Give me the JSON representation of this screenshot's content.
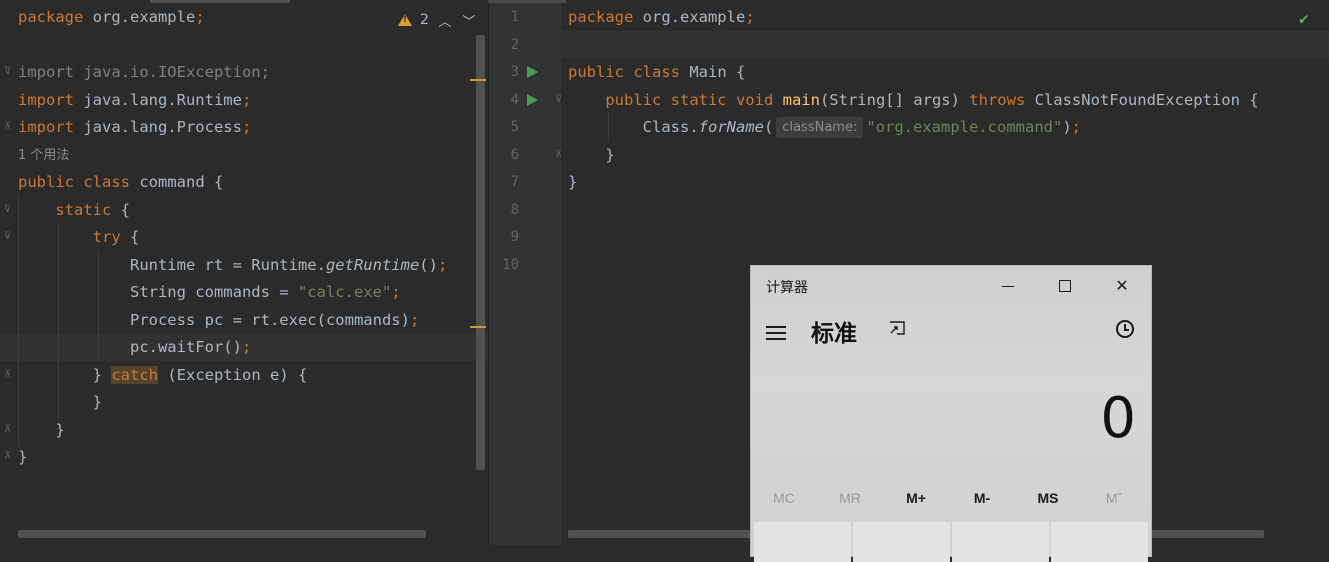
{
  "left_editor": {
    "warnings": {
      "count": "2"
    },
    "lines": [
      "package org.example;",
      "",
      "import java.io.IOException;",
      "import java.lang.Runtime;",
      "import java.lang.Process;",
      "1 个用法",
      "public class command {",
      "    static {",
      "        try {",
      "            Runtime rt = Runtime.getRuntime();",
      "            String commands = \"calc.exe\";",
      "            Process pc = rt.exec(commands);",
      "            pc.waitFor();",
      "        } catch (Exception e) {",
      "        }",
      "    }",
      "}"
    ]
  },
  "right_editor": {
    "line_numbers": [
      "1",
      "2",
      "3",
      "4",
      "5",
      "6",
      "7",
      "8",
      "9",
      "10"
    ],
    "lines": [
      "package org.example;",
      "",
      "public class Main {",
      "    public static void main(String[] args) throws ClassNotFoundException {",
      "        Class.forName(",
      "    }",
      "}"
    ],
    "param_hint": "className:",
    "forname_arg": "\"org.example.command\");"
  },
  "calculator": {
    "title": "计算器",
    "mode": "标准",
    "display": "0",
    "memory_buttons": [
      "MC",
      "MR",
      "M+",
      "M-",
      "MS",
      "Mˇ"
    ],
    "memory_disabled": [
      true,
      true,
      false,
      false,
      false,
      true
    ]
  },
  "colors": {
    "editor_bg": "#2b2b2b",
    "keyword": "#cc7832",
    "string": "#6a8759",
    "method": "#ffc66d",
    "text": "#a9b7c6",
    "warning": "#e0a030",
    "run": "#499c54"
  }
}
